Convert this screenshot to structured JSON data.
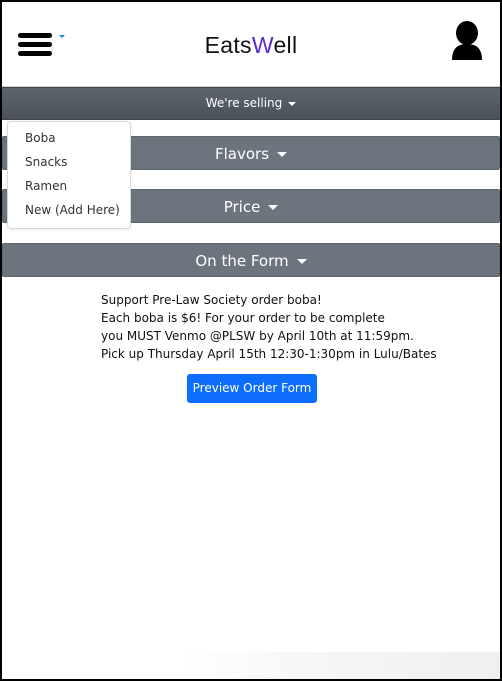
{
  "navbar": {
    "brand_prefix": "Eats",
    "brand_accent": "W",
    "brand_suffix": "ell",
    "menu_icon": "hamburger-icon",
    "user_icon": "user-icon"
  },
  "selling": {
    "label": "We're selling",
    "items": [
      "Boba",
      "Snacks",
      "Ramen",
      "New (Add Here)"
    ]
  },
  "sections": {
    "flavors": "Flavors",
    "price": "Price",
    "form": "On the Form"
  },
  "info": {
    "lines": [
      "Support Pre-Law Society order boba!",
      "Each boba is $6! For your order to be complete",
      "you MUST Venmo @PLSW by April 10th at 11:59pm.",
      "Pick up Thursday April 15th 12:30-1:30pm in Lulu/Bates"
    ]
  },
  "preview_button": "Preview Order Form",
  "colors": {
    "accent": "#5b2bd6",
    "primary_button": "#0d6efd",
    "section_button": "#6c757d",
    "selling_bar": "#535a62"
  }
}
